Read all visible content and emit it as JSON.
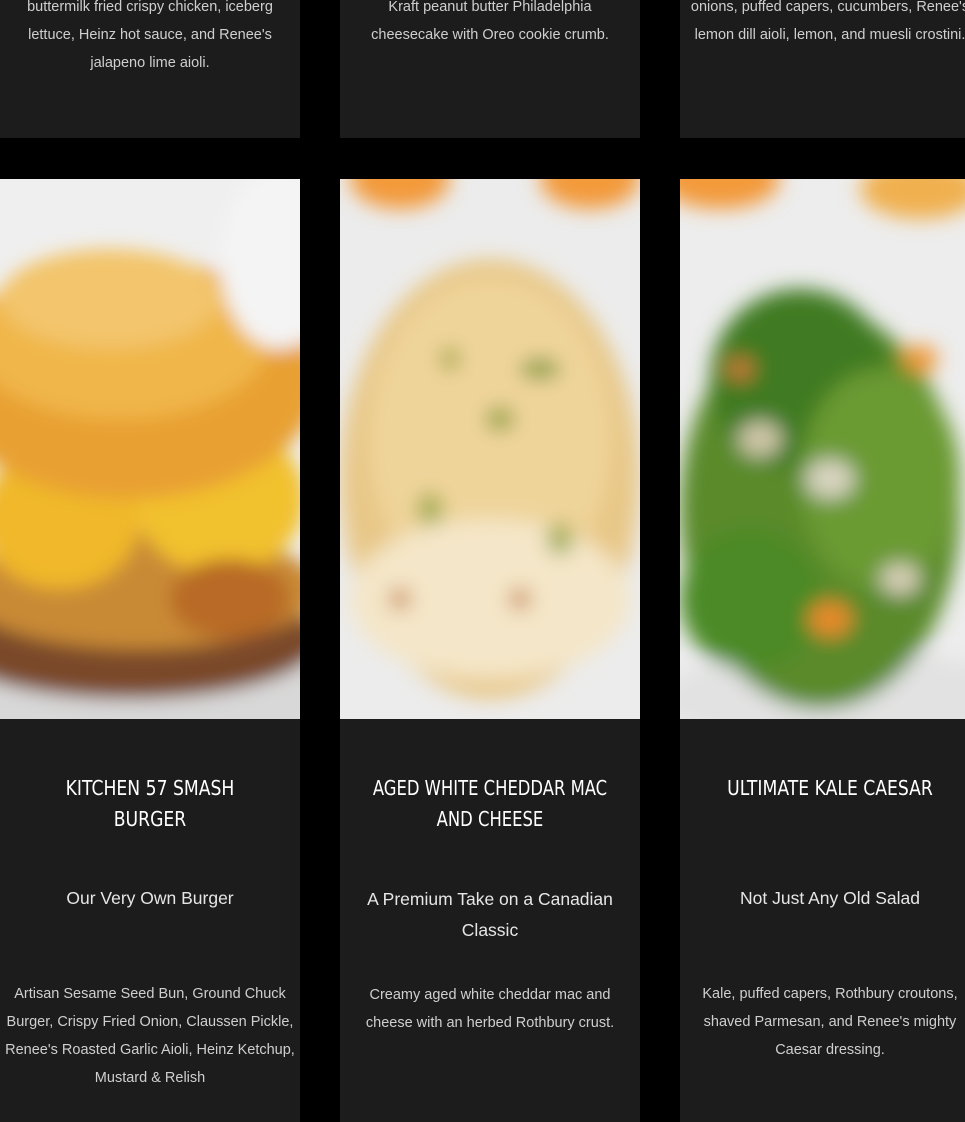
{
  "top_row": [
    {
      "description": "buttermilk fried crispy chicken, iceberg lettuce, Heinz hot sauce, and Renee's jalapeno lime aioli."
    },
    {
      "description": "Kraft peanut butter Philadelphia cheesecake with Oreo cookie crumb."
    },
    {
      "description": "onions, puffed capers, cucumbers, Renee's lemon dill aioli, lemon, and muesli crostini."
    }
  ],
  "menu_items": [
    {
      "title": "KITCHEN 57 SMASH BURGER",
      "subtitle": "Our Very Own Burger",
      "description": "Artisan Sesame Seed Bun, Ground Chuck Burger, Crispy Fried Onion, Claussen Pickle, Renee's Roasted Garlic Aioli, Heinz Ketchup, Mustard & Relish",
      "photo_icon": "burger-photo"
    },
    {
      "title": "AGED WHITE CHEDDAR MAC AND CHEESE",
      "subtitle": "A Premium Take on a Canadian Classic",
      "description": "Creamy aged white cheddar mac and cheese with an herbed Rothbury crust.",
      "photo_icon": "mac-and-cheese-photo"
    },
    {
      "title": "ULTIMATE KALE CAESAR",
      "subtitle": "Not Just Any Old Salad",
      "description": "Kale, puffed capers, Rothbury croutons, shaved Parmesan, and Renee's mighty Caesar dressing.",
      "photo_icon": "kale-caesar-photo"
    }
  ],
  "colors": {
    "page_background": "#000000",
    "card_background": "#1c1c1c",
    "title_text": "#ffffff",
    "body_text": "#cfcfcf"
  }
}
